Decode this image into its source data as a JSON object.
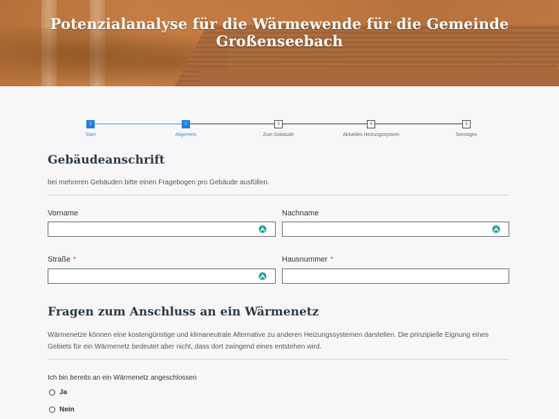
{
  "header": {
    "title": "Potenzialanalyse für die Wärmewende für die Gemeinde Großenseebach"
  },
  "stepper": {
    "steps": [
      {
        "number": "1",
        "label": "Start",
        "active": true
      },
      {
        "number": "2",
        "label": "Allgemein",
        "active": true
      },
      {
        "number": "3",
        "label": "Zum Gebäude",
        "active": false
      },
      {
        "number": "4",
        "label": "Aktuelles Heizungssystem",
        "active": false
      },
      {
        "number": "5",
        "label": "Sonstiges",
        "active": false
      }
    ]
  },
  "section_address": {
    "title": "Gebäudeanschrift",
    "description": "bei mehreren Gebäuden bitte einen Fragebogen pro Gebäude ausfüllen.",
    "fields": {
      "first_name": {
        "label": "Vorname",
        "value": ""
      },
      "last_name": {
        "label": "Nachname",
        "value": ""
      },
      "street": {
        "label": "Straße",
        "required_marker": "*",
        "value": ""
      },
      "house_number": {
        "label": "Hausnummer",
        "required_marker": "*",
        "value": ""
      }
    }
  },
  "section_network": {
    "title": "Fragen zum Anschluss an ein Wärmenetz",
    "description": "Wärmenetze können eine kostengünstige und klimaneutrale Alternative zu anderen Heizungssystemen darstellen. Die prinzipielle Eignung eines Gebiets für ein Wärmenetz bedeutet aber nicht, dass dort zwingend eines entstehen wird.",
    "question": "Ich bin bereits an ein Wärmenetz angeschlossen",
    "options": [
      "Ja",
      "Nein"
    ]
  },
  "colors": {
    "accent": "#1e7ee8",
    "progress_line": "#2f9bd6",
    "required": "#e0453a",
    "autofill_icon": "#1aa39a"
  }
}
